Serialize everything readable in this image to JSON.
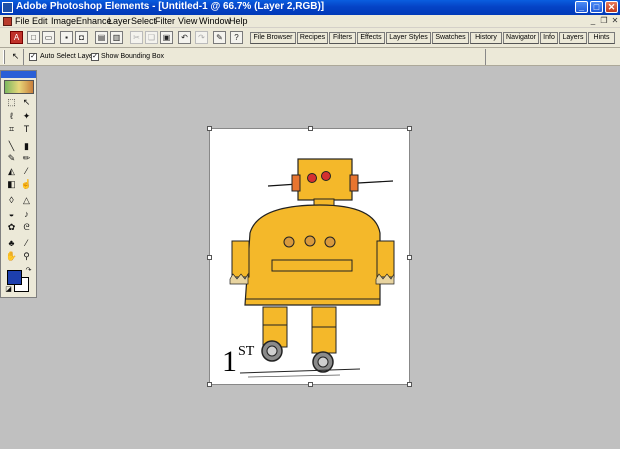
{
  "window": {
    "title": "Adobe Photoshop Elements - [Untitled-1 @ 66.7% (Layer 2,RGB)]",
    "buttons": {
      "minimize": "_",
      "maximize": "□",
      "close": "✕"
    }
  },
  "menubar": {
    "items": [
      {
        "label": "File"
      },
      {
        "label": "Edit"
      },
      {
        "label": "Image"
      },
      {
        "label": "Enhance"
      },
      {
        "label": "Layer"
      },
      {
        "label": "Select"
      },
      {
        "label": "Filter"
      },
      {
        "label": "View"
      },
      {
        "label": "Window"
      },
      {
        "label": "Help"
      }
    ],
    "doc_buttons": {
      "minimize": "_",
      "restore": "❐",
      "close": "✕"
    }
  },
  "shortcuts": {
    "palette_tabs": [
      {
        "label": "File Browser"
      },
      {
        "label": "Recipes"
      },
      {
        "label": "Filters"
      },
      {
        "label": "Effects"
      },
      {
        "label": "Layer Styles"
      },
      {
        "label": "Swatches"
      },
      {
        "label": "History"
      },
      {
        "label": "Navigator"
      },
      {
        "label": "Info"
      },
      {
        "label": "Layers"
      },
      {
        "label": "Hints"
      }
    ]
  },
  "options": {
    "auto_select_layer": {
      "label": "Auto Select Layer",
      "checked": true
    },
    "show_bounding_box": {
      "label": "Show Bounding Box",
      "checked": true
    }
  },
  "canvas": {
    "document_text": "1",
    "document_superscript": "ST"
  },
  "colors": {
    "foreground": "#1d3fae",
    "background": "#ffffff",
    "workspace": "#c0c0c0",
    "robot_body": "#f4b82a"
  }
}
